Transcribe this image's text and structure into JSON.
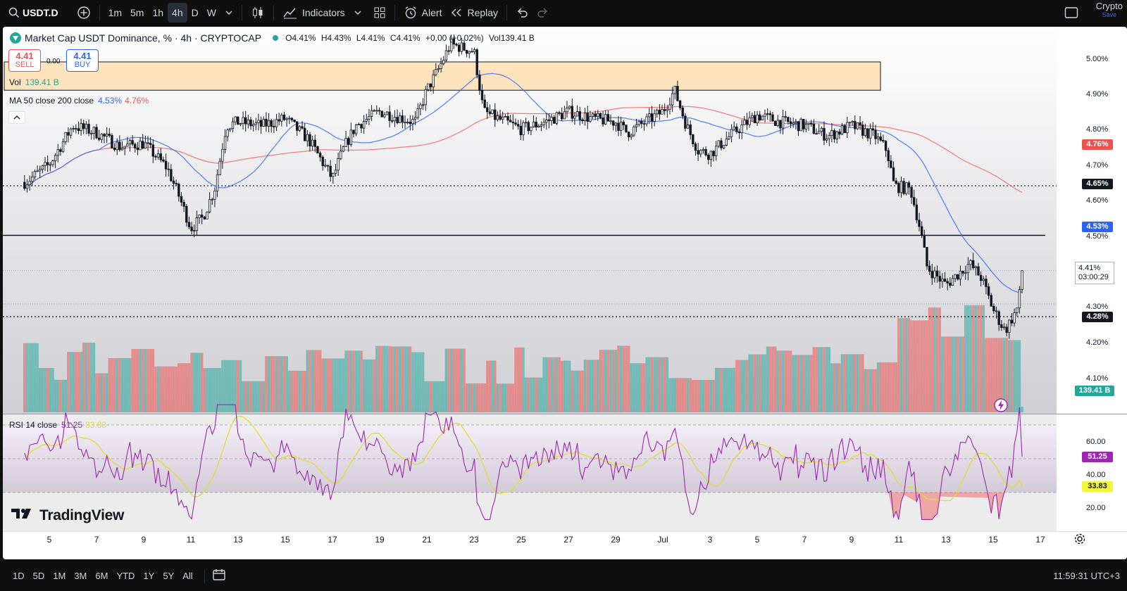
{
  "toolbar": {
    "symbol": "USDT.D",
    "intervals": [
      "1m",
      "5m",
      "1h",
      "4h",
      "D",
      "W"
    ],
    "active_interval": "4h",
    "indicators_label": "Indicators",
    "alert_label": "Alert",
    "replay_label": "Replay",
    "crypto_label": "Crypto",
    "save_label": "Save"
  },
  "legend": {
    "title": "Market Cap USDT Dominance, % · 4h · CRYPTOCAP",
    "open": "O4.41%",
    "high": "H4.43%",
    "low": "L4.41%",
    "close": "C4.41%",
    "change": "+0.00 (+0.02%)",
    "volume": "Vol139.41 B"
  },
  "trade": {
    "sell_price": "4.41",
    "sell_label": "SELL",
    "buy_price": "4.41",
    "buy_label": "BUY",
    "spread": "0.00"
  },
  "volume_legend": {
    "label": "Vol",
    "value": "139.41 B"
  },
  "ma_legend": {
    "label": "MA 50 close 200 close",
    "ma50": "4.53%",
    "ma200": "4.76%"
  },
  "rsi_legend": {
    "label": "RSI 14 close",
    "rsi": "51.25",
    "ma": "33.83"
  },
  "brand": "TradingView",
  "price_axis": {
    "ticks": [
      "5.00%",
      "4.90%",
      "4.80%",
      "4.70%",
      "4.60%",
      "4.50%",
      "4.30%",
      "4.20%",
      "4.10%"
    ],
    "badge_ma200": "4.76%",
    "badge_level_465": "4.65%",
    "badge_ma50": "4.53%",
    "badge_level_428": "4.28%",
    "current_price": "4.41%",
    "countdown": "03:00:29",
    "volume_badge": "139.41 B"
  },
  "rsi_axis": {
    "ticks": [
      "60.00",
      "40.00",
      "20.00"
    ],
    "rsi_badge": "51.25",
    "ma_badge": "33.83"
  },
  "time_axis": {
    "labels": [
      "5",
      "7",
      "9",
      "11",
      "13",
      "15",
      "17",
      "19",
      "21",
      "23",
      "25",
      "27",
      "29",
      "Jul",
      "3",
      "5",
      "7",
      "9",
      "11",
      "13",
      "15",
      "17"
    ]
  },
  "bottom_bar": {
    "ranges": [
      "1D",
      "5D",
      "1M",
      "3M",
      "6M",
      "YTD",
      "1Y",
      "5Y",
      "All"
    ],
    "clock": "11:59:31 UTC+3"
  },
  "colors": {
    "up": "#26a69a",
    "down": "#ef5350",
    "ma50": "#2962ff",
    "ma200": "#ef5350",
    "rsi": "#9c27b0",
    "rsi_ma": "#dede36",
    "zone": "#ffe0b2"
  },
  "chart_data": {
    "type": "candlestick",
    "title": "Market Cap USDT Dominance, % · 4h · CRYPTOCAP",
    "y_unit": "%",
    "ylim": [
      4.03,
      5.1
    ],
    "x_labels": [
      "5",
      "7",
      "9",
      "11",
      "13",
      "15",
      "17",
      "19",
      "21",
      "23",
      "25",
      "27",
      "29",
      "Jul",
      "3",
      "5",
      "7",
      "9",
      "11",
      "13",
      "15",
      "17"
    ],
    "close_path": [
      [
        4,
        4.66
      ],
      [
        5,
        4.71
      ],
      [
        6,
        4.82
      ],
      [
        7,
        4.8
      ],
      [
        8,
        4.76
      ],
      [
        9,
        4.77
      ],
      [
        10,
        4.7
      ],
      [
        10.5,
        4.62
      ],
      [
        11,
        4.53
      ],
      [
        11.5,
        4.56
      ],
      [
        12,
        4.64
      ],
      [
        12.5,
        4.82
      ],
      [
        13,
        4.83
      ],
      [
        14,
        4.82
      ],
      [
        15,
        4.84
      ],
      [
        16,
        4.78
      ],
      [
        17,
        4.67
      ],
      [
        17.5,
        4.76
      ],
      [
        18,
        4.82
      ],
      [
        19,
        4.86
      ],
      [
        20,
        4.84
      ],
      [
        20.5,
        4.83
      ],
      [
        21,
        4.92
      ],
      [
        21.5,
        4.98
      ],
      [
        22,
        5.05
      ],
      [
        23,
        5.03
      ],
      [
        23.4,
        4.86
      ],
      [
        24,
        4.84
      ],
      [
        25,
        4.81
      ],
      [
        26,
        4.83
      ],
      [
        27,
        4.86
      ],
      [
        28,
        4.84
      ],
      [
        29,
        4.83
      ],
      [
        29.5,
        4.8
      ],
      [
        30,
        4.82
      ],
      [
        31,
        4.86
      ],
      [
        31.5,
        4.92
      ],
      [
        32,
        4.82
      ],
      [
        32.5,
        4.75
      ],
      [
        33,
        4.74
      ],
      [
        34,
        4.8
      ],
      [
        35,
        4.85
      ],
      [
        36,
        4.83
      ],
      [
        37,
        4.82
      ],
      [
        38,
        4.79
      ],
      [
        39,
        4.82
      ],
      [
        40,
        4.79
      ],
      [
        40.5,
        4.75
      ],
      [
        40.8,
        4.65
      ],
      [
        41.5,
        4.64
      ],
      [
        41.9,
        4.53
      ],
      [
        42.2,
        4.42
      ],
      [
        43,
        4.37
      ],
      [
        44,
        4.43
      ],
      [
        44.5,
        4.39
      ],
      [
        45,
        4.3
      ],
      [
        45.5,
        4.24
      ],
      [
        46,
        4.3
      ],
      [
        46.3,
        4.41
      ]
    ],
    "levels": [
      5.0,
      4.92,
      4.65,
      4.51,
      4.28
    ],
    "ma50": {
      "name": "MA 50 close",
      "last": 4.53
    },
    "ma200": {
      "name": "MA 200 close",
      "last": 4.76
    },
    "last_price": 4.41,
    "volume_last": "139.41 B",
    "rsi": {
      "name": "RSI 14 close",
      "last": 51.25,
      "ma_last": 33.83,
      "ylim": [
        10,
        80
      ],
      "bands": [
        70,
        50,
        30
      ]
    }
  }
}
